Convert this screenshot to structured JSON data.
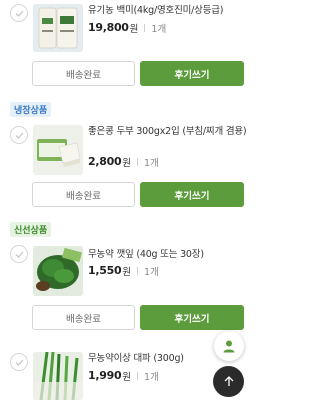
{
  "colors": {
    "accent": "#5c9c3c",
    "cold_badge": "#3a79c1",
    "fresh_badge": "#3b8a2a"
  },
  "orders": [
    {
      "name": "유기농 백미(4kg/영호진미/상등급)",
      "price": "19,800",
      "currency": "원",
      "qty": "1개",
      "shipped_label": "배송완료",
      "review_label": "후기쓰기"
    },
    {
      "category": "냉장상품",
      "name": "좋은콩 두부 300gx2입 (부침/찌개 겸용)",
      "price": "2,800",
      "currency": "원",
      "qty": "1개",
      "shipped_label": "배송완료",
      "review_label": "후기쓰기"
    },
    {
      "category": "신선상품",
      "name": "무농약 깻잎 (40g 또는 30장)",
      "price": "1,550",
      "currency": "원",
      "qty": "1개",
      "shipped_label": "배송완료",
      "review_label": "후기쓰기"
    },
    {
      "name": "무농약이상 대파 (300g)",
      "price": "1,990",
      "currency": "원",
      "qty": "1개"
    }
  ],
  "fabs": {
    "profile_icon": "person-icon",
    "top_icon": "arrow-up-icon"
  }
}
